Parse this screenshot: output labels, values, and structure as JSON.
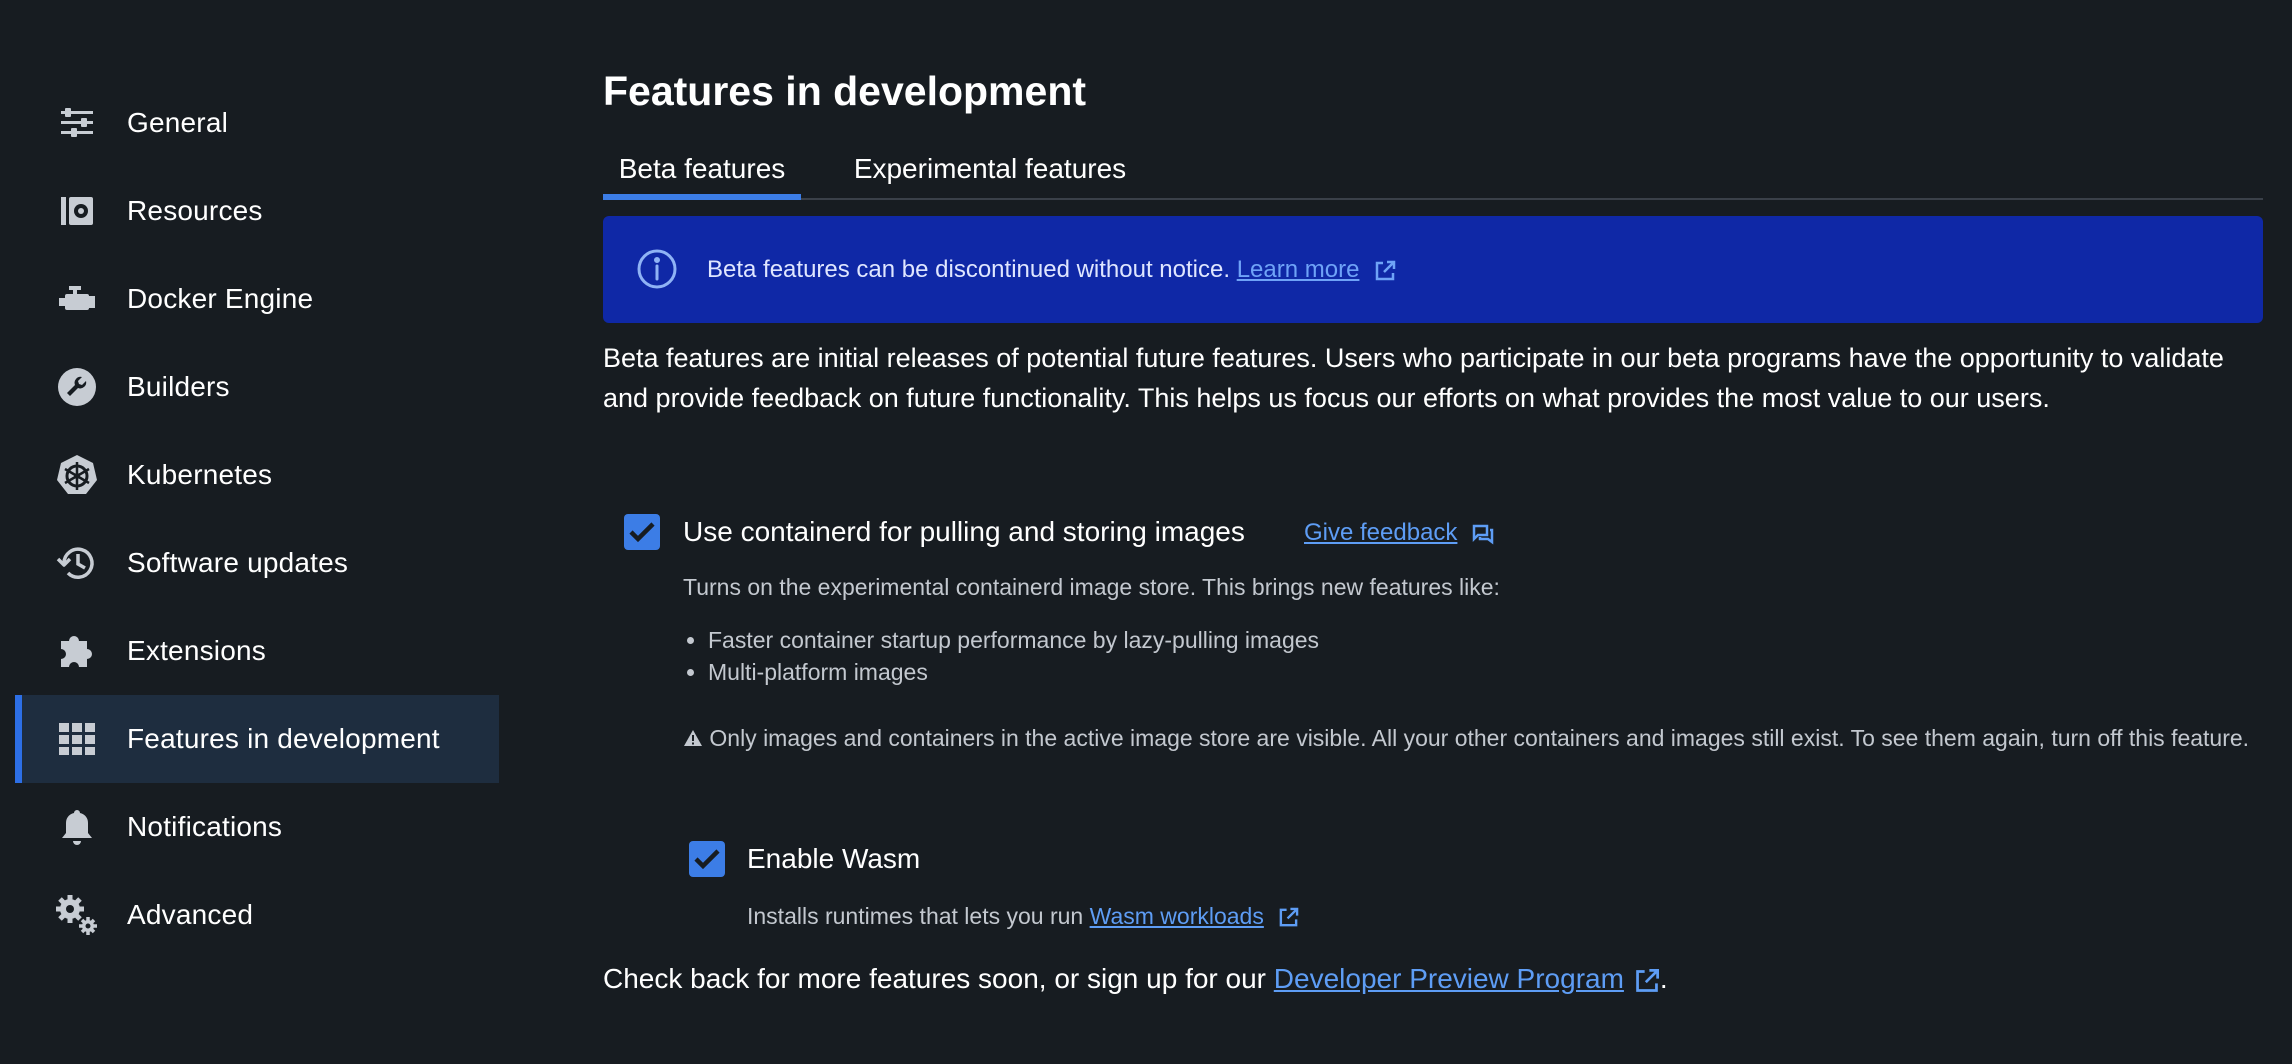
{
  "sidebar": {
    "items": [
      {
        "label": "General",
        "icon": "sliders-icon"
      },
      {
        "label": "Resources",
        "icon": "resources-icon"
      },
      {
        "label": "Docker Engine",
        "icon": "engine-icon"
      },
      {
        "label": "Builders",
        "icon": "wrench-icon"
      },
      {
        "label": "Kubernetes",
        "icon": "kubernetes-icon"
      },
      {
        "label": "Software updates",
        "icon": "history-icon"
      },
      {
        "label": "Extensions",
        "icon": "puzzle-icon"
      },
      {
        "label": "Features in development",
        "icon": "grid-icon",
        "active": true
      },
      {
        "label": "Notifications",
        "icon": "bell-icon"
      },
      {
        "label": "Advanced",
        "icon": "gears-icon"
      }
    ]
  },
  "main": {
    "title": "Features in development",
    "tabs": [
      {
        "label": "Beta features",
        "active": true
      },
      {
        "label": "Experimental features",
        "active": false
      }
    ],
    "banner": {
      "text": "Beta features can be discontinued without notice.",
      "link": "Learn more"
    },
    "intro": "Beta features are initial releases of potential future features. Users who participate in our beta programs have the opportunity to validate and provide feedback on future functionality. This helps us focus our efforts on what provides the most value to our users.",
    "features": {
      "containerd": {
        "checked": true,
        "label": "Use containerd for pulling and storing images",
        "feedback_link": "Give feedback",
        "description": "Turns on the experimental containerd image store. This brings new features like:",
        "bullets": [
          "Faster container startup performance by lazy-pulling images",
          "Multi-platform images"
        ],
        "warning": "Only images and containers in the active image store are visible. All your other containers and images still exist. To see them again, turn off this feature."
      },
      "wasm": {
        "checked": true,
        "label": "Enable Wasm",
        "description": "Installs runtimes that lets you run",
        "link": "Wasm workloads"
      }
    },
    "footer": {
      "text": "Check back for more features soon, or sign up for our",
      "link": "Developer Preview Program",
      "suffix": "."
    }
  },
  "colors": {
    "background": "#171c21",
    "accent": "#3c7de6",
    "banner": "#0f28a6",
    "link": "#5e9df5",
    "active_nav": "#1e2d3f"
  }
}
